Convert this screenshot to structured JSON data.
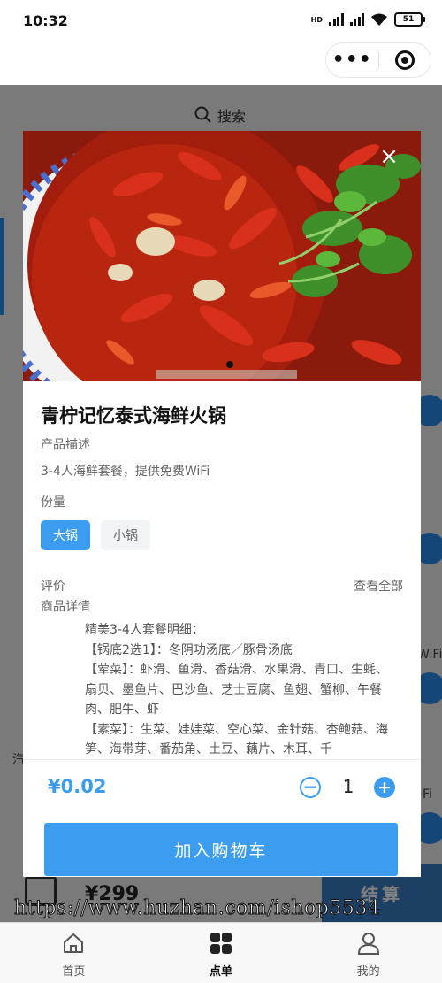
{
  "status_bar": {
    "time": "10:32",
    "network": "HD",
    "battery": "51",
    "icons": [
      "signal-icon",
      "signal-icon",
      "wifi-icon",
      "battery-icon"
    ]
  },
  "capsule": {
    "more_icon": "more-dots-icon",
    "close_icon": "target-close-icon"
  },
  "background": {
    "search_label": "搜索",
    "cart_total": "¥299",
    "checkout_label": "结算",
    "side_labels": [
      "WiFi",
      "Fi",
      "汽"
    ]
  },
  "product": {
    "name": "青柠记忆泰式海鲜火锅",
    "desc_label": "产品描述",
    "description": "3-4人海鲜套餐，提供免费WiFi",
    "portion_label": "份量",
    "options": [
      "大锅",
      "小锅"
    ],
    "selected_option": "大锅",
    "review_label": "评价",
    "view_all": "查看全部",
    "detail_label": "商品详情",
    "detail_lines": [
      "精美3-4人套餐明细：",
      "【锅底2选1】：冬阴功汤底／豚骨汤底",
      "【荤菜】：虾滑、鱼滑、香菇滑、水果滑、青口、生蚝、扇贝、墨鱼片、巴沙鱼、芝士豆腐、鱼翅、蟹柳、午餐肉、肥牛、虾",
      "【素菜】：生菜、娃娃菜、空心菜、金针菇、杏鲍菇、海笋、海带芽、番茄角、土豆、藕片、木耳、千"
    ],
    "price": "¥0.02",
    "quantity": "1",
    "add_to_cart": "加入购物车"
  },
  "watermark": "https://www.huzhan.com/ishop5534",
  "tabs": [
    {
      "label": "首页",
      "icon": "home-icon",
      "active": false
    },
    {
      "label": "点单",
      "icon": "grid-icon",
      "active": true
    },
    {
      "label": "我的",
      "icon": "user-icon",
      "active": false
    }
  ],
  "colors": {
    "accent": "#3c9df0",
    "checkout": "#3d7ec9"
  }
}
